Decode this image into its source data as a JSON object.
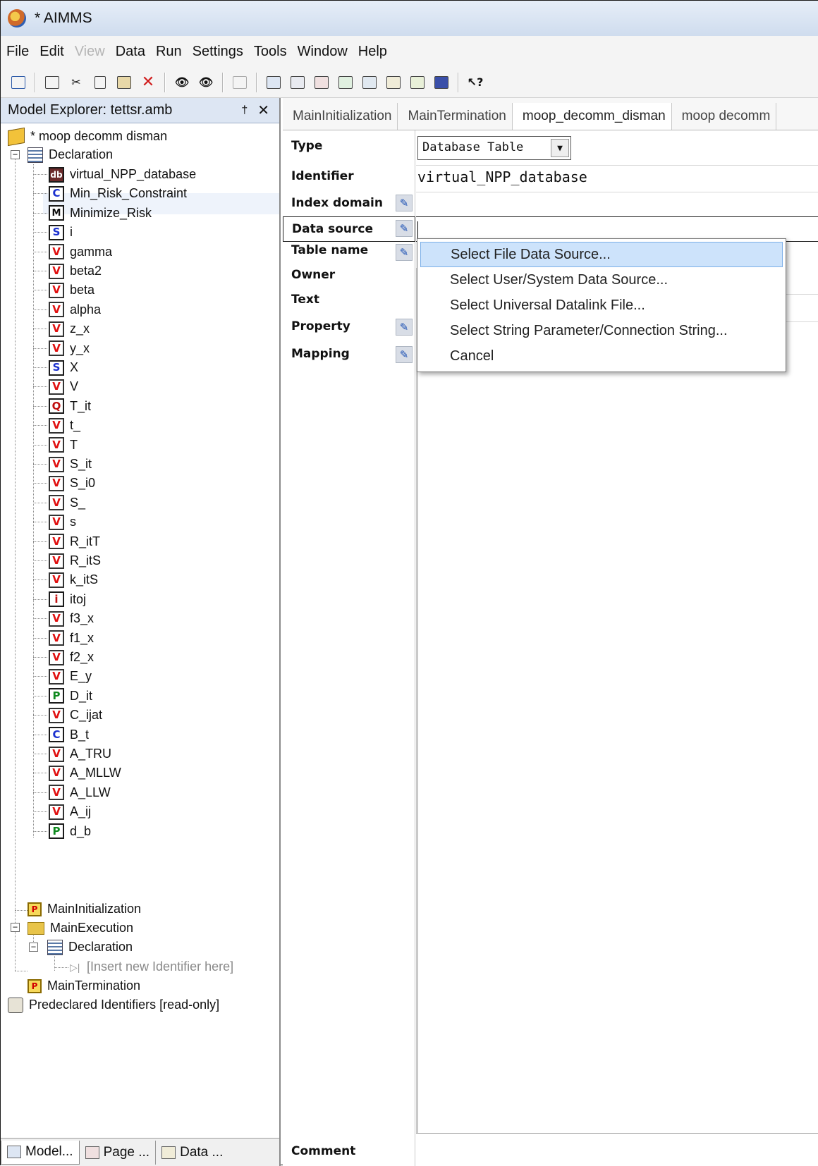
{
  "window": {
    "title": "* AIMMS"
  },
  "menu": [
    "File",
    "Edit",
    "View",
    "Data",
    "Run",
    "Settings",
    "Tools",
    "Window",
    "Help"
  ],
  "menu_disabled": [
    "View"
  ],
  "explorer": {
    "header": "Model Explorer: tettsr.amb",
    "pin": "†",
    "close": "✕",
    "root": "* moop decomm disman",
    "declaration": "Declaration",
    "identifiers": [
      {
        "type": "db",
        "badge": "db",
        "name": "virtual_NPP_database"
      },
      {
        "type": "C",
        "badge": "C",
        "name": "Min_Risk_Constraint"
      },
      {
        "type": "M",
        "badge": "M",
        "name": "Minimize_Risk"
      },
      {
        "type": "S",
        "badge": "S",
        "name": "i"
      },
      {
        "type": "V",
        "badge": "V",
        "name": "gamma"
      },
      {
        "type": "V",
        "badge": "V",
        "name": "beta2"
      },
      {
        "type": "V",
        "badge": "V",
        "name": "beta"
      },
      {
        "type": "V",
        "badge": "V",
        "name": "alpha"
      },
      {
        "type": "V",
        "badge": "V",
        "name": "z_x"
      },
      {
        "type": "V",
        "badge": "V",
        "name": "y_x"
      },
      {
        "type": "S",
        "badge": "S",
        "name": "X"
      },
      {
        "type": "V",
        "badge": "V",
        "name": "V"
      },
      {
        "type": "Q",
        "badge": "Q",
        "name": "T_it"
      },
      {
        "type": "V",
        "badge": "V",
        "name": "t_"
      },
      {
        "type": "V",
        "badge": "V",
        "name": "T"
      },
      {
        "type": "V",
        "badge": "V",
        "name": "S_it"
      },
      {
        "type": "V",
        "badge": "V",
        "name": "S_i0"
      },
      {
        "type": "V",
        "badge": "V",
        "name": "S_"
      },
      {
        "type": "V",
        "badge": "V",
        "name": "s"
      },
      {
        "type": "V",
        "badge": "V",
        "name": "R_itT"
      },
      {
        "type": "V",
        "badge": "V",
        "name": "R_itS"
      },
      {
        "type": "V",
        "badge": "V",
        "name": "k_itS"
      },
      {
        "type": "i",
        "badge": "i",
        "name": "itoj"
      },
      {
        "type": "V",
        "badge": "V",
        "name": "f3_x"
      },
      {
        "type": "V",
        "badge": "V",
        "name": "f1_x"
      },
      {
        "type": "V",
        "badge": "V",
        "name": "f2_x"
      },
      {
        "type": "V",
        "badge": "V",
        "name": "E_y"
      },
      {
        "type": "P",
        "badge": "P",
        "name": "D_it"
      },
      {
        "type": "V",
        "badge": "V",
        "name": "C_ijat"
      },
      {
        "type": "C",
        "badge": "C",
        "name": "B_t"
      },
      {
        "type": "V",
        "badge": "V",
        "name": "A_TRU"
      },
      {
        "type": "V",
        "badge": "V",
        "name": "A_MLLW"
      },
      {
        "type": "V",
        "badge": "V",
        "name": "A_LLW"
      },
      {
        "type": "V",
        "badge": "V",
        "name": "A_ij"
      },
      {
        "type": "P",
        "badge": "P",
        "name": "d_b"
      }
    ],
    "main_init": "MainInitialization",
    "main_exec": "MainExecution",
    "exec_declaration": "Declaration",
    "insert_placeholder": "[Insert new Identifier here]",
    "main_term": "MainTermination",
    "predeclared": "Predeclared Identifiers [read-only]",
    "bottom_tabs": [
      "Model...",
      "Page ...",
      "Data ..."
    ]
  },
  "editor": {
    "tabs": [
      "MainInitialization",
      "MainTermination",
      "moop_decomm_disman",
      "moop decomm"
    ],
    "attributes": {
      "type_label": "Type",
      "identifier_label": "Identifier",
      "index_domain_label": "Index domain",
      "data_source_label": "Data source",
      "table_name_label": "Table name",
      "owner_label": "Owner",
      "text_label": "Text",
      "property_label": "Property",
      "mapping_label": "Mapping",
      "comment_label": "Comment"
    },
    "type_value": "Database Table",
    "identifier_value": "virtual_NPP_database"
  },
  "popup": {
    "items": [
      "Select File Data Source...",
      "Select User/System Data Source...",
      "Select Universal Datalink File...",
      "Select String Parameter/Connection String...",
      "Cancel"
    ],
    "highlighted": "Select File Data Source..."
  },
  "colors": {
    "variable_badge": "#e01010",
    "set_badge": "#1a2fcf",
    "parameter_badge": "#0f8a1f",
    "menu_highlight": "#cde3fb"
  }
}
